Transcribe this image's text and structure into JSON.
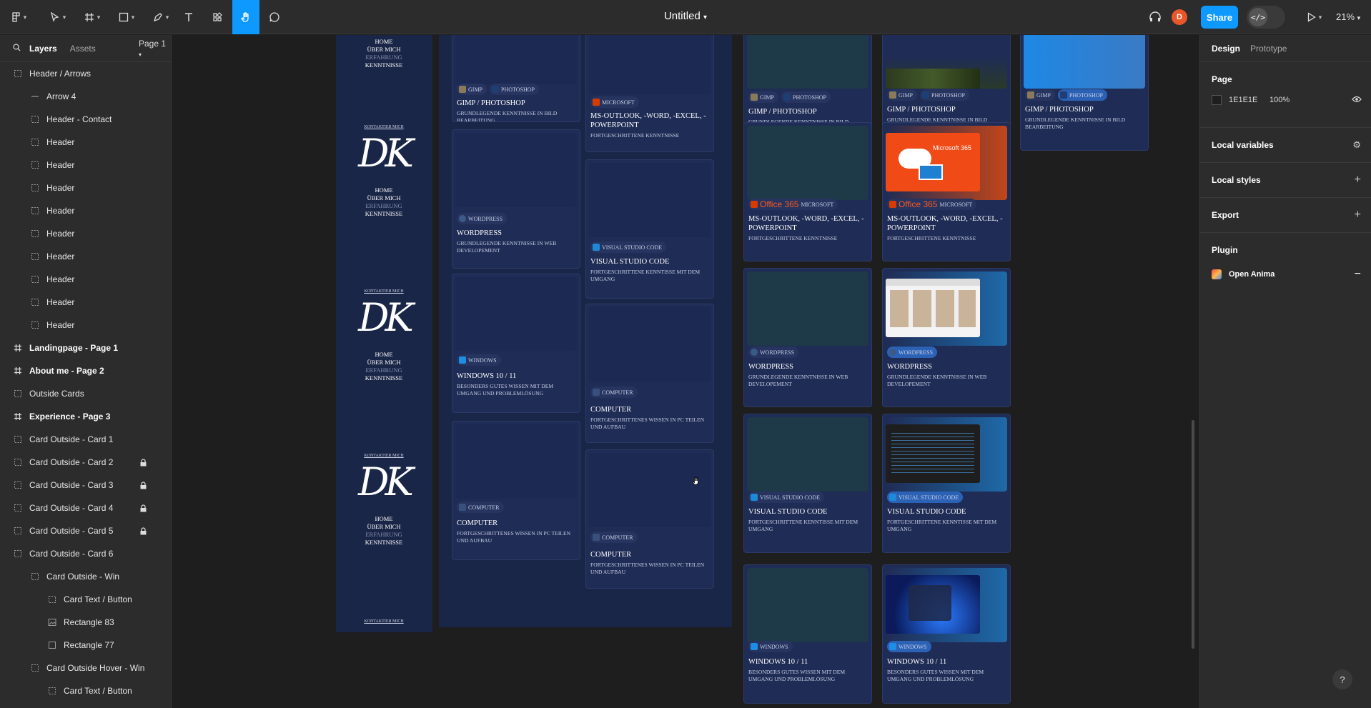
{
  "toolbar": {
    "title": "Untitled",
    "share": "Share",
    "avatar": "D",
    "zoom": "21%",
    "dev_mode": "</>"
  },
  "left_panel": {
    "tabs": [
      "Layers",
      "Assets"
    ],
    "page_select": "Page 1",
    "layers": [
      {
        "name": "Header / Arrows",
        "icon": "component-set-icon",
        "indent": 0,
        "bold": false,
        "locked": false
      },
      {
        "name": "Arrow 4",
        "icon": "line-icon",
        "indent": 1,
        "bold": false,
        "locked": false
      },
      {
        "name": "Header - Contact",
        "icon": "component-set-icon",
        "indent": 1,
        "bold": false,
        "locked": false
      },
      {
        "name": "Header",
        "icon": "component-set-icon",
        "indent": 1,
        "bold": false,
        "locked": false
      },
      {
        "name": "Header",
        "icon": "component-set-icon",
        "indent": 1,
        "bold": false,
        "locked": false
      },
      {
        "name": "Header",
        "icon": "component-set-icon",
        "indent": 1,
        "bold": false,
        "locked": false
      },
      {
        "name": "Header",
        "icon": "component-set-icon",
        "indent": 1,
        "bold": false,
        "locked": false
      },
      {
        "name": "Header",
        "icon": "component-set-icon",
        "indent": 1,
        "bold": false,
        "locked": false
      },
      {
        "name": "Header",
        "icon": "component-set-icon",
        "indent": 1,
        "bold": false,
        "locked": false
      },
      {
        "name": "Header",
        "icon": "component-set-icon",
        "indent": 1,
        "bold": false,
        "locked": false
      },
      {
        "name": "Header",
        "icon": "component-set-icon",
        "indent": 1,
        "bold": false,
        "locked": false
      },
      {
        "name": "Header",
        "icon": "component-set-icon",
        "indent": 1,
        "bold": false,
        "locked": false
      },
      {
        "name": "Landingpage - Page 1",
        "icon": "frame-icon",
        "indent": 0,
        "bold": true,
        "locked": false
      },
      {
        "name": "About me - Page 2",
        "icon": "frame-icon",
        "indent": 0,
        "bold": true,
        "locked": false
      },
      {
        "name": "Outside Cards",
        "icon": "component-set-icon",
        "indent": 0,
        "bold": false,
        "locked": false
      },
      {
        "name": "Experience - Page 3",
        "icon": "frame-icon",
        "indent": 0,
        "bold": true,
        "locked": false
      },
      {
        "name": "Card Outside - Card 1",
        "icon": "component-set-icon",
        "indent": 0,
        "bold": false,
        "locked": false
      },
      {
        "name": "Card Outside - Card 2",
        "icon": "component-set-icon",
        "indent": 0,
        "bold": false,
        "locked": true
      },
      {
        "name": "Card Outside - Card 3",
        "icon": "component-set-icon",
        "indent": 0,
        "bold": false,
        "locked": true
      },
      {
        "name": "Card Outside - Card 4",
        "icon": "component-set-icon",
        "indent": 0,
        "bold": false,
        "locked": true
      },
      {
        "name": "Card Outside - Card 5",
        "icon": "component-set-icon",
        "indent": 0,
        "bold": false,
        "locked": true
      },
      {
        "name": "Card Outside - Card 6",
        "icon": "component-set-icon",
        "indent": 0,
        "bold": false,
        "locked": false
      },
      {
        "name": "Card Outside - Win",
        "icon": "component-set-icon",
        "indent": 1,
        "bold": false,
        "locked": false
      },
      {
        "name": "Card Text / Button",
        "icon": "component-set-icon",
        "indent": 2,
        "bold": false,
        "locked": false
      },
      {
        "name": "Rectangle 83",
        "icon": "image-icon",
        "indent": 2,
        "bold": false,
        "locked": false
      },
      {
        "name": "Rectangle 77",
        "icon": "rectangle-icon",
        "indent": 2,
        "bold": false,
        "locked": false
      },
      {
        "name": "Card Outside Hover - Win",
        "icon": "component-set-icon",
        "indent": 1,
        "bold": false,
        "locked": false
      },
      {
        "name": "Card Text / Button",
        "icon": "component-set-icon",
        "indent": 2,
        "bold": false,
        "locked": false
      }
    ]
  },
  "right_panel": {
    "tabs": [
      "Design",
      "Prototype"
    ],
    "page_label": "Page",
    "page_color": "1E1E1E",
    "page_opacity": "100%",
    "sections": [
      "Local variables",
      "Local styles",
      "Export"
    ],
    "plugin_label": "Plugin",
    "plugin_name": "Open Anima",
    "help": "?"
  },
  "canvas": {
    "nav": {
      "contact": "KONTAKTIER MICH",
      "logo": "DK",
      "items": [
        "HOME",
        "ÜBER MICH",
        "ERFAHRUNG",
        "KENNTNISSE"
      ]
    },
    "texts": {
      "gimp": "GIMP",
      "photoshop": "PHOTOSHOP",
      "gimp_title": "GIMP / PHOTOSHOP",
      "gimp_desc": "GRUNDLEGENDE KENNTNISSE IN BILD BEARBEITUNG",
      "microsoft": "MICROSOFT",
      "office": "Office 365",
      "ms_title": "MS-OUTLOOK, -WORD, -EXCEL, -POWERPOINT",
      "ms_desc": "FORTGESCHRITTENE KENNTNISSE",
      "wordpress": "WORDPRESS",
      "wp_desc": "GRUNDLEGENDE KENNTNISSE IN WEB DEVELOPEMENT",
      "vscode": "VISUAL STUDIO CODE",
      "vs_desc": "FORTGESCHRITTENE KENNTISSE MIT DEM UMGANG",
      "windows": "WINDOWS",
      "win_title": "WINDOWS 10 / 11",
      "win_desc": "BESONDERS GUTES WISSEN MIT DEM UMGANG UND PROBLEMLÖSUNG",
      "computer": "COMPUTER",
      "pc_desc": "FORTGESCHRITTENES WISSEN IN PC TEILEN UND AUFBAU",
      "m365": "Microsoft 365"
    }
  },
  "colors": {
    "accent": "#0d99ff",
    "avatar": "#e8572a",
    "card": "#1f2c55",
    "navy": "#1a2647"
  }
}
